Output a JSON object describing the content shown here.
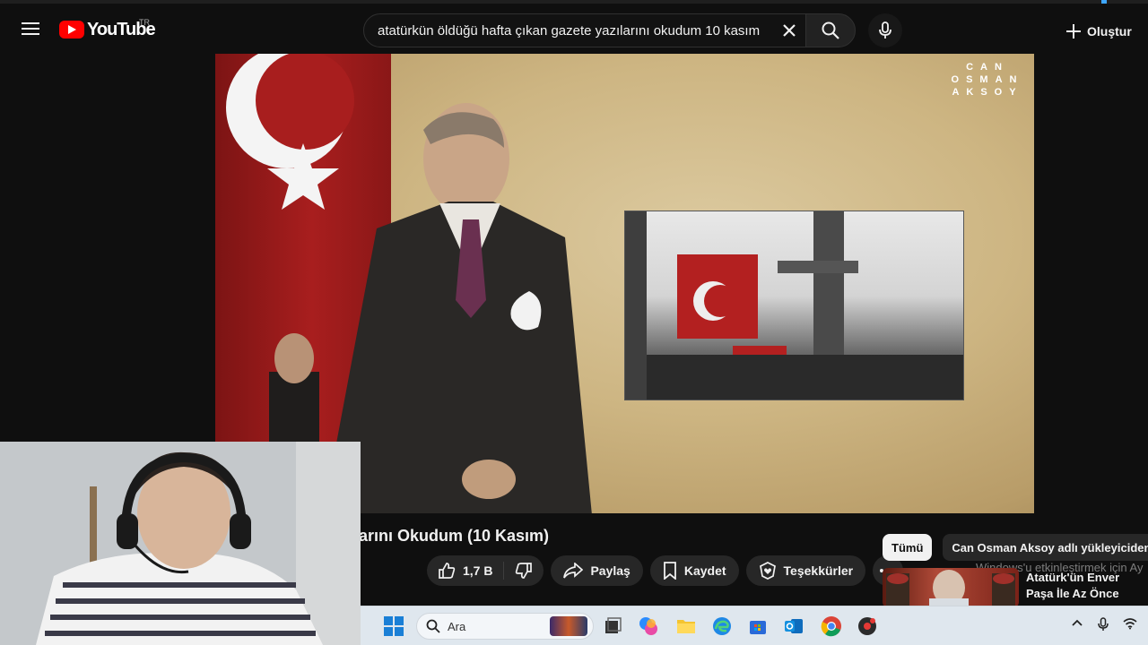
{
  "masthead": {
    "logo_text": "YouTube",
    "region_code": "TR",
    "search_query": "atatürkün öldüğü hafta çıkan gazete yazılarını okudum 10 kasım",
    "create_label": "Oluştur"
  },
  "video": {
    "watermark_lines": [
      "CAN",
      "OSMAN",
      "AKSOY"
    ],
    "title": "arını Okudum (10 Kasım)"
  },
  "actions": {
    "like_count": "1,7 B",
    "share_label": "Paylaş",
    "save_label": "Kaydet",
    "thanks_label": "Teşekkürler"
  },
  "sidebar": {
    "chips": [
      {
        "label": "Tümü",
        "active": true
      },
      {
        "label": "Can Osman Aksoy adlı yükleyiciden",
        "active": false
      }
    ],
    "windows_notice": "Windows'u etkinleştirmek için Ay",
    "recommendation_title": "Atatürk'ün Enver Paşa İle Az Önce Konuştum"
  },
  "taskbar": {
    "search_placeholder": "Ara"
  },
  "colors": {
    "youtube_red": "#ff0000",
    "background": "#0f0f0f",
    "pill": "#272727",
    "taskbar": "#dfe7ee"
  },
  "icons": [
    "menu-icon",
    "youtube-logo-icon",
    "close-icon",
    "search-icon",
    "mic-icon",
    "plus-icon",
    "thumb-up-icon",
    "thumb-down-icon",
    "share-icon",
    "bookmark-icon",
    "thanks-icon",
    "more-icon",
    "windows-start-icon",
    "task-view-icon",
    "copilot-icon",
    "file-explorer-icon",
    "edge-icon",
    "store-icon",
    "outlook-icon",
    "chrome-icon",
    "app-icon",
    "chevron-up-icon",
    "mic-tray-icon",
    "wifi-icon"
  ]
}
